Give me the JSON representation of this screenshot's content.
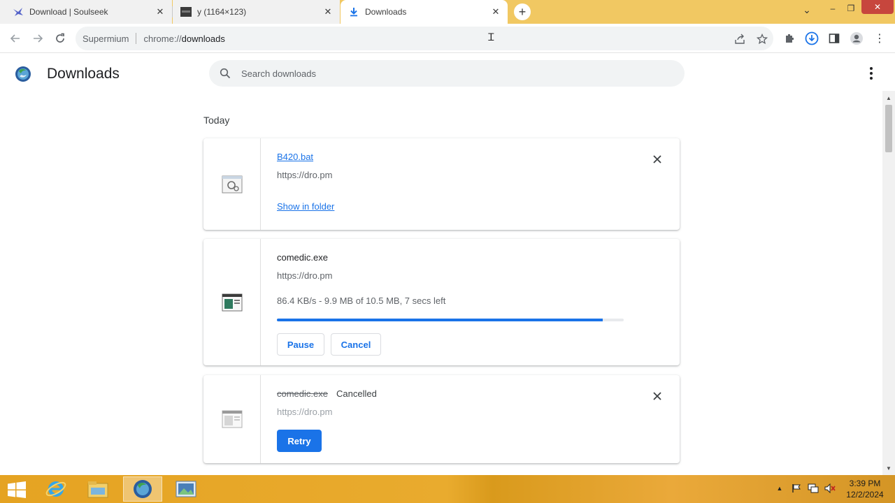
{
  "tabs": [
    {
      "title": "Download | Soulseek",
      "icon": "soulseek-bird-icon",
      "active": false
    },
    {
      "title": "y (1164×123)",
      "icon": "image-thumbnail-icon",
      "active": false
    },
    {
      "title": "Downloads",
      "icon": "download-arrow-icon",
      "active": true
    }
  ],
  "window_controls": {
    "minimize": "–",
    "restore": "❐",
    "close": "✕",
    "dropdown": "⌄"
  },
  "omnibox": {
    "site_name": "Supermium",
    "scheme": "chrome://",
    "path": "downloads"
  },
  "page": {
    "title": "Downloads",
    "search_placeholder": "Search downloads",
    "section_label": "Today"
  },
  "downloads": [
    {
      "filename": "B420.bat",
      "url": "https://dro.pm",
      "action_link": "Show in folder",
      "state": "complete"
    },
    {
      "filename": "comedic.exe",
      "url": "https://dro.pm",
      "progress_text": "86.4 KB/s - 9.9 MB of 10.5 MB, 7 secs left",
      "progress_fraction": 0.94,
      "pause_label": "Pause",
      "cancel_label": "Cancel",
      "state": "in_progress"
    },
    {
      "filename": "comedic.exe",
      "status": "Cancelled",
      "url": "https://dro.pm",
      "retry_label": "Retry",
      "state": "cancelled"
    }
  ],
  "taskbar": {
    "apps": [
      "internet-explorer-icon",
      "file-explorer-icon",
      "supermium-browser-icon",
      "image-viewer-icon"
    ],
    "clock": {
      "time": "3:39 PM",
      "date": "12/2/2024"
    }
  },
  "colors": {
    "accent": "#1a73e8",
    "tabstrip": "#f1c862",
    "taskbar": "#e5a322"
  }
}
